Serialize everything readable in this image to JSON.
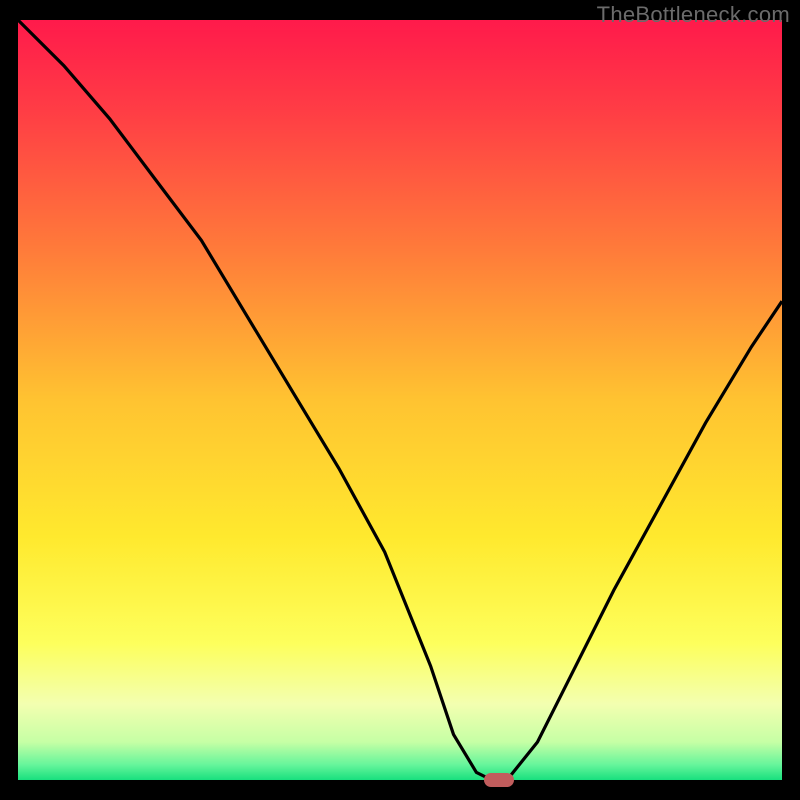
{
  "watermark": "TheBottleneck.com",
  "chart_data": {
    "type": "line",
    "title": "",
    "xlabel": "",
    "ylabel": "",
    "xlim": [
      0,
      100
    ],
    "ylim": [
      0,
      100
    ],
    "grid": false,
    "legend": false,
    "series": [
      {
        "name": "bottleneck-curve",
        "x": [
          0,
          6,
          12,
          18,
          24,
          30,
          36,
          42,
          48,
          54,
          57,
          60,
          62,
          64,
          68,
          72,
          78,
          84,
          90,
          96,
          100
        ],
        "values": [
          100,
          94,
          87,
          79,
          71,
          61,
          51,
          41,
          30,
          15,
          6,
          1,
          0,
          0,
          5,
          13,
          25,
          36,
          47,
          57,
          63
        ]
      }
    ],
    "marker": {
      "x": 63,
      "y": 0,
      "name": "optimal-point"
    },
    "gradient_stops": [
      {
        "pct": 0,
        "color": "#ff1a4b"
      },
      {
        "pct": 12,
        "color": "#ff3d45"
      },
      {
        "pct": 30,
        "color": "#ff7a3a"
      },
      {
        "pct": 50,
        "color": "#ffc331"
      },
      {
        "pct": 68,
        "color": "#ffe92e"
      },
      {
        "pct": 82,
        "color": "#fdff5c"
      },
      {
        "pct": 90,
        "color": "#f3ffb0"
      },
      {
        "pct": 95,
        "color": "#c6ffa5"
      },
      {
        "pct": 98,
        "color": "#66f59b"
      },
      {
        "pct": 100,
        "color": "#18e07e"
      }
    ]
  }
}
